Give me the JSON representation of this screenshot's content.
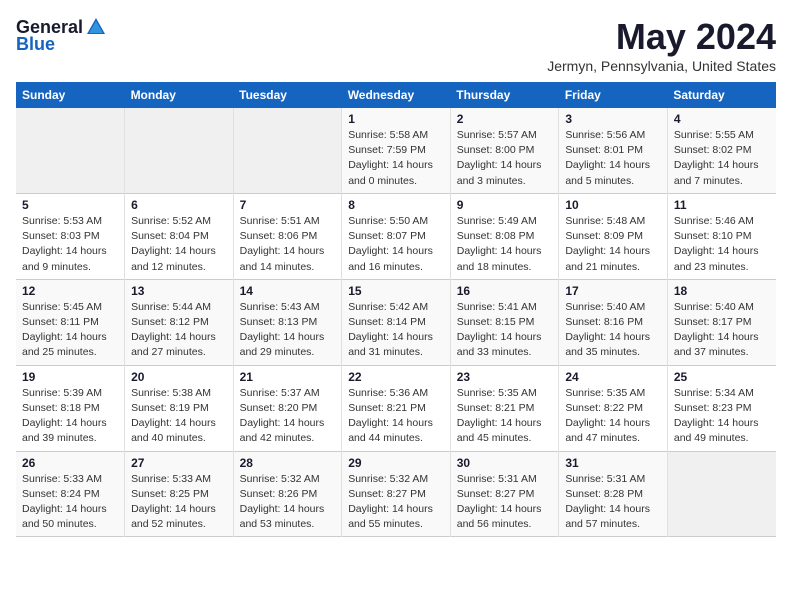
{
  "logo": {
    "general": "General",
    "blue": "Blue"
  },
  "header": {
    "month": "May 2024",
    "location": "Jermyn, Pennsylvania, United States"
  },
  "weekdays": [
    "Sunday",
    "Monday",
    "Tuesday",
    "Wednesday",
    "Thursday",
    "Friday",
    "Saturday"
  ],
  "weeks": [
    [
      {
        "day": "",
        "sunrise": "",
        "sunset": "",
        "daylight": ""
      },
      {
        "day": "",
        "sunrise": "",
        "sunset": "",
        "daylight": ""
      },
      {
        "day": "",
        "sunrise": "",
        "sunset": "",
        "daylight": ""
      },
      {
        "day": "1",
        "sunrise": "Sunrise: 5:58 AM",
        "sunset": "Sunset: 7:59 PM",
        "daylight": "Daylight: 14 hours and 0 minutes."
      },
      {
        "day": "2",
        "sunrise": "Sunrise: 5:57 AM",
        "sunset": "Sunset: 8:00 PM",
        "daylight": "Daylight: 14 hours and 3 minutes."
      },
      {
        "day": "3",
        "sunrise": "Sunrise: 5:56 AM",
        "sunset": "Sunset: 8:01 PM",
        "daylight": "Daylight: 14 hours and 5 minutes."
      },
      {
        "day": "4",
        "sunrise": "Sunrise: 5:55 AM",
        "sunset": "Sunset: 8:02 PM",
        "daylight": "Daylight: 14 hours and 7 minutes."
      }
    ],
    [
      {
        "day": "5",
        "sunrise": "Sunrise: 5:53 AM",
        "sunset": "Sunset: 8:03 PM",
        "daylight": "Daylight: 14 hours and 9 minutes."
      },
      {
        "day": "6",
        "sunrise": "Sunrise: 5:52 AM",
        "sunset": "Sunset: 8:04 PM",
        "daylight": "Daylight: 14 hours and 12 minutes."
      },
      {
        "day": "7",
        "sunrise": "Sunrise: 5:51 AM",
        "sunset": "Sunset: 8:06 PM",
        "daylight": "Daylight: 14 hours and 14 minutes."
      },
      {
        "day": "8",
        "sunrise": "Sunrise: 5:50 AM",
        "sunset": "Sunset: 8:07 PM",
        "daylight": "Daylight: 14 hours and 16 minutes."
      },
      {
        "day": "9",
        "sunrise": "Sunrise: 5:49 AM",
        "sunset": "Sunset: 8:08 PM",
        "daylight": "Daylight: 14 hours and 18 minutes."
      },
      {
        "day": "10",
        "sunrise": "Sunrise: 5:48 AM",
        "sunset": "Sunset: 8:09 PM",
        "daylight": "Daylight: 14 hours and 21 minutes."
      },
      {
        "day": "11",
        "sunrise": "Sunrise: 5:46 AM",
        "sunset": "Sunset: 8:10 PM",
        "daylight": "Daylight: 14 hours and 23 minutes."
      }
    ],
    [
      {
        "day": "12",
        "sunrise": "Sunrise: 5:45 AM",
        "sunset": "Sunset: 8:11 PM",
        "daylight": "Daylight: 14 hours and 25 minutes."
      },
      {
        "day": "13",
        "sunrise": "Sunrise: 5:44 AM",
        "sunset": "Sunset: 8:12 PM",
        "daylight": "Daylight: 14 hours and 27 minutes."
      },
      {
        "day": "14",
        "sunrise": "Sunrise: 5:43 AM",
        "sunset": "Sunset: 8:13 PM",
        "daylight": "Daylight: 14 hours and 29 minutes."
      },
      {
        "day": "15",
        "sunrise": "Sunrise: 5:42 AM",
        "sunset": "Sunset: 8:14 PM",
        "daylight": "Daylight: 14 hours and 31 minutes."
      },
      {
        "day": "16",
        "sunrise": "Sunrise: 5:41 AM",
        "sunset": "Sunset: 8:15 PM",
        "daylight": "Daylight: 14 hours and 33 minutes."
      },
      {
        "day": "17",
        "sunrise": "Sunrise: 5:40 AM",
        "sunset": "Sunset: 8:16 PM",
        "daylight": "Daylight: 14 hours and 35 minutes."
      },
      {
        "day": "18",
        "sunrise": "Sunrise: 5:40 AM",
        "sunset": "Sunset: 8:17 PM",
        "daylight": "Daylight: 14 hours and 37 minutes."
      }
    ],
    [
      {
        "day": "19",
        "sunrise": "Sunrise: 5:39 AM",
        "sunset": "Sunset: 8:18 PM",
        "daylight": "Daylight: 14 hours and 39 minutes."
      },
      {
        "day": "20",
        "sunrise": "Sunrise: 5:38 AM",
        "sunset": "Sunset: 8:19 PM",
        "daylight": "Daylight: 14 hours and 40 minutes."
      },
      {
        "day": "21",
        "sunrise": "Sunrise: 5:37 AM",
        "sunset": "Sunset: 8:20 PM",
        "daylight": "Daylight: 14 hours and 42 minutes."
      },
      {
        "day": "22",
        "sunrise": "Sunrise: 5:36 AM",
        "sunset": "Sunset: 8:21 PM",
        "daylight": "Daylight: 14 hours and 44 minutes."
      },
      {
        "day": "23",
        "sunrise": "Sunrise: 5:35 AM",
        "sunset": "Sunset: 8:21 PM",
        "daylight": "Daylight: 14 hours and 45 minutes."
      },
      {
        "day": "24",
        "sunrise": "Sunrise: 5:35 AM",
        "sunset": "Sunset: 8:22 PM",
        "daylight": "Daylight: 14 hours and 47 minutes."
      },
      {
        "day": "25",
        "sunrise": "Sunrise: 5:34 AM",
        "sunset": "Sunset: 8:23 PM",
        "daylight": "Daylight: 14 hours and 49 minutes."
      }
    ],
    [
      {
        "day": "26",
        "sunrise": "Sunrise: 5:33 AM",
        "sunset": "Sunset: 8:24 PM",
        "daylight": "Daylight: 14 hours and 50 minutes."
      },
      {
        "day": "27",
        "sunrise": "Sunrise: 5:33 AM",
        "sunset": "Sunset: 8:25 PM",
        "daylight": "Daylight: 14 hours and 52 minutes."
      },
      {
        "day": "28",
        "sunrise": "Sunrise: 5:32 AM",
        "sunset": "Sunset: 8:26 PM",
        "daylight": "Daylight: 14 hours and 53 minutes."
      },
      {
        "day": "29",
        "sunrise": "Sunrise: 5:32 AM",
        "sunset": "Sunset: 8:27 PM",
        "daylight": "Daylight: 14 hours and 55 minutes."
      },
      {
        "day": "30",
        "sunrise": "Sunrise: 5:31 AM",
        "sunset": "Sunset: 8:27 PM",
        "daylight": "Daylight: 14 hours and 56 minutes."
      },
      {
        "day": "31",
        "sunrise": "Sunrise: 5:31 AM",
        "sunset": "Sunset: 8:28 PM",
        "daylight": "Daylight: 14 hours and 57 minutes."
      },
      {
        "day": "",
        "sunrise": "",
        "sunset": "",
        "daylight": ""
      }
    ]
  ]
}
